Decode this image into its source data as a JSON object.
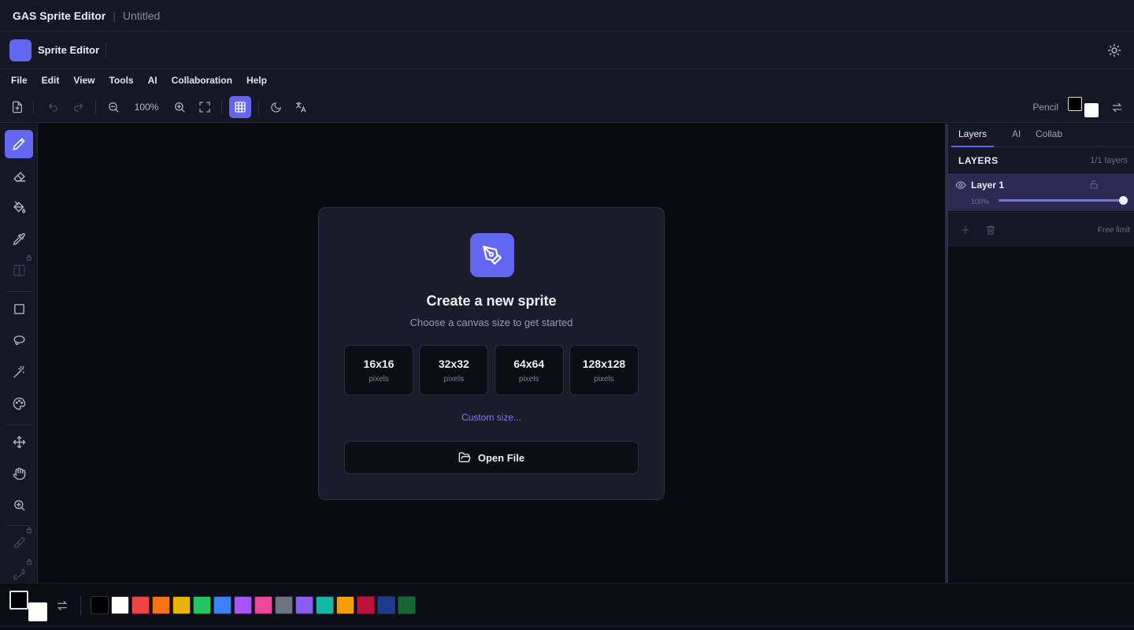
{
  "window": {
    "app_title": "GAS Sprite Editor",
    "separator": "|",
    "document": "Untitled"
  },
  "app": {
    "name": "Sprite Editor"
  },
  "menu": [
    "File",
    "Edit",
    "View",
    "Tools",
    "AI",
    "Collaboration",
    "Help"
  ],
  "toolbar": {
    "zoom": "100%",
    "current_tool": "Pencil"
  },
  "rail_tools": [
    "pencil",
    "eraser",
    "fill",
    "eyedropper",
    "symmetry",
    "rectangle",
    "lasso",
    "magic-wand",
    "palette",
    "move",
    "hand",
    "zoom",
    "brush",
    "bone"
  ],
  "start_card": {
    "title": "Create a new sprite",
    "subtitle": "Choose a canvas size to get started",
    "sizes": [
      {
        "value": "16x16",
        "unit": "pixels"
      },
      {
        "value": "32x32",
        "unit": "pixels"
      },
      {
        "value": "64x64",
        "unit": "pixels"
      },
      {
        "value": "128x128",
        "unit": "pixels"
      }
    ],
    "custom_link": "Custom size...",
    "open_file": "Open File"
  },
  "panel": {
    "tabs": [
      "Layers",
      "AI",
      "Collab"
    ],
    "active_tab": "Layers",
    "layers_title": "LAYERS",
    "layers_count": "1/1 layers",
    "layers": [
      {
        "name": "Layer 1",
        "opacity_label": "100%",
        "opacity": 1.0
      }
    ],
    "limit_text": "Free limit"
  },
  "colors": {
    "accent": "#6366f1",
    "foreground": "#000000",
    "background": "#ffffff",
    "palette": [
      "#000000",
      "#ffffff",
      "#ef4444",
      "#f97316",
      "#eab308",
      "#22c55e",
      "#3b82f6",
      "#a855f7",
      "#ec4899",
      "#6b7280",
      "#8b5cf6",
      "#14b8a6",
      "#f59e0b",
      "#be123c",
      "#1e3a8a",
      "#166534"
    ]
  }
}
